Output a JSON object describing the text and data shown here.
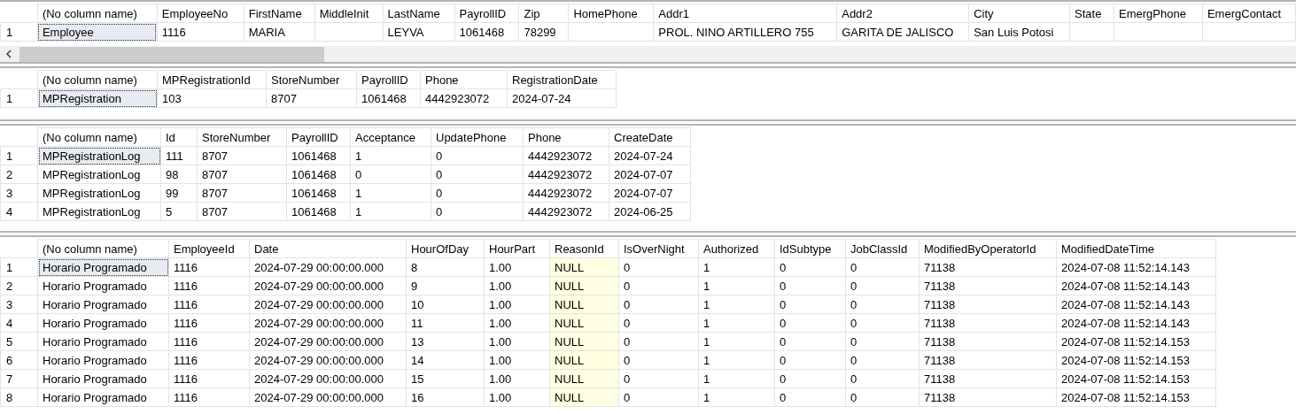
{
  "result_grids": [
    {
      "horizontal_scrollbar": true,
      "columns": [
        {
          "label": "(No column name)"
        },
        {
          "label": "EmployeeNo"
        },
        {
          "label": "FirstName"
        },
        {
          "label": "MiddleInit"
        },
        {
          "label": "LastName"
        },
        {
          "label": "PayrollID"
        },
        {
          "label": "Zip"
        },
        {
          "label": "HomePhone"
        },
        {
          "label": "Addr1"
        },
        {
          "label": "Addr2"
        },
        {
          "label": "City"
        },
        {
          "label": "State"
        },
        {
          "label": "EmergPhone"
        },
        {
          "label": "EmergContact"
        }
      ],
      "rows": [
        {
          "number": "1",
          "selected": true,
          "cells": [
            "Employee",
            "1116",
            "MARIA",
            null,
            "LEYVA",
            "1061468",
            "78299",
            null,
            "PROL. NINO ARTILLERO 755",
            "GARITA DE JALISCO",
            "San Luis Potosi",
            null,
            null,
            null
          ]
        }
      ]
    },
    {
      "horizontal_scrollbar": false,
      "columns": [
        {
          "label": "(No column name)"
        },
        {
          "label": "MPRegistrationId"
        },
        {
          "label": "StoreNumber"
        },
        {
          "label": "PayrollID"
        },
        {
          "label": "Phone"
        },
        {
          "label": "RegistrationDate"
        }
      ],
      "rows": [
        {
          "number": "1",
          "selected": true,
          "cells": [
            "MPRegistration",
            "103",
            "8707",
            "1061468",
            "4442923072",
            "2024-07-24"
          ]
        }
      ]
    },
    {
      "horizontal_scrollbar": false,
      "columns": [
        {
          "label": "(No column name)"
        },
        {
          "label": "Id"
        },
        {
          "label": "StoreNumber"
        },
        {
          "label": "PayrollID"
        },
        {
          "label": "Acceptance"
        },
        {
          "label": "UpdatePhone"
        },
        {
          "label": "Phone"
        },
        {
          "label": "CreateDate"
        }
      ],
      "rows": [
        {
          "number": "1",
          "selected": true,
          "cells": [
            "MPRegistrationLog",
            "111",
            "8707",
            "1061468",
            "1",
            "0",
            "4442923072",
            "2024-07-24"
          ]
        },
        {
          "number": "2",
          "selected": false,
          "cells": [
            "MPRegistrationLog",
            "98",
            "8707",
            "1061468",
            "0",
            "0",
            "4442923072",
            "2024-07-07"
          ]
        },
        {
          "number": "3",
          "selected": false,
          "cells": [
            "MPRegistrationLog",
            "99",
            "8707",
            "1061468",
            "1",
            "0",
            "4442923072",
            "2024-07-07"
          ]
        },
        {
          "number": "4",
          "selected": false,
          "cells": [
            "MPRegistrationLog",
            "5",
            "8707",
            "1061468",
            "1",
            "0",
            "4442923072",
            "2024-06-25"
          ]
        }
      ]
    },
    {
      "horizontal_scrollbar": false,
      "columns": [
        {
          "label": "(No column name)"
        },
        {
          "label": "EmployeeId"
        },
        {
          "label": "Date"
        },
        {
          "label": "HourOfDay"
        },
        {
          "label": "HourPart"
        },
        {
          "label": "ReasonId",
          "null_highlight": true
        },
        {
          "label": "IsOverNight"
        },
        {
          "label": "Authorized"
        },
        {
          "label": "IdSubtype"
        },
        {
          "label": "JobClassId"
        },
        {
          "label": "ModifiedByOperatorId"
        },
        {
          "label": "ModifiedDateTime"
        }
      ],
      "rows": [
        {
          "number": "1",
          "selected": true,
          "cells": [
            "Horario Programado",
            "1116",
            "2024-07-29 00:00:00.000",
            "8",
            "1.00",
            "NULL",
            "0",
            "1",
            "0",
            "0",
            "71138",
            "2024-07-08 11:52:14.143"
          ]
        },
        {
          "number": "2",
          "selected": false,
          "cells": [
            "Horario Programado",
            "1116",
            "2024-07-29 00:00:00.000",
            "9",
            "1.00",
            "NULL",
            "0",
            "1",
            "0",
            "0",
            "71138",
            "2024-07-08 11:52:14.143"
          ]
        },
        {
          "number": "3",
          "selected": false,
          "cells": [
            "Horario Programado",
            "1116",
            "2024-07-29 00:00:00.000",
            "10",
            "1.00",
            "NULL",
            "0",
            "1",
            "0",
            "0",
            "71138",
            "2024-07-08 11:52:14.143"
          ]
        },
        {
          "number": "4",
          "selected": false,
          "cells": [
            "Horario Programado",
            "1116",
            "2024-07-29 00:00:00.000",
            "11",
            "1.00",
            "NULL",
            "0",
            "1",
            "0",
            "0",
            "71138",
            "2024-07-08 11:52:14.143"
          ]
        },
        {
          "number": "5",
          "selected": false,
          "cells": [
            "Horario Programado",
            "1116",
            "2024-07-29 00:00:00.000",
            "13",
            "1.00",
            "NULL",
            "0",
            "1",
            "0",
            "0",
            "71138",
            "2024-07-08 11:52:14.153"
          ]
        },
        {
          "number": "6",
          "selected": false,
          "cells": [
            "Horario Programado",
            "1116",
            "2024-07-29 00:00:00.000",
            "14",
            "1.00",
            "NULL",
            "0",
            "1",
            "0",
            "0",
            "71138",
            "2024-07-08 11:52:14.153"
          ]
        },
        {
          "number": "7",
          "selected": false,
          "cells": [
            "Horario Programado",
            "1116",
            "2024-07-29 00:00:00.000",
            "15",
            "1.00",
            "NULL",
            "0",
            "1",
            "0",
            "0",
            "71138",
            "2024-07-08 11:52:14.153"
          ]
        },
        {
          "number": "8",
          "selected": false,
          "cells": [
            "Horario Programado",
            "1116",
            "2024-07-29 00:00:00.000",
            "16",
            "1.00",
            "NULL",
            "0",
            "1",
            "0",
            "0",
            "71138",
            "2024-07-08 11:52:14.153"
          ]
        }
      ]
    }
  ]
}
